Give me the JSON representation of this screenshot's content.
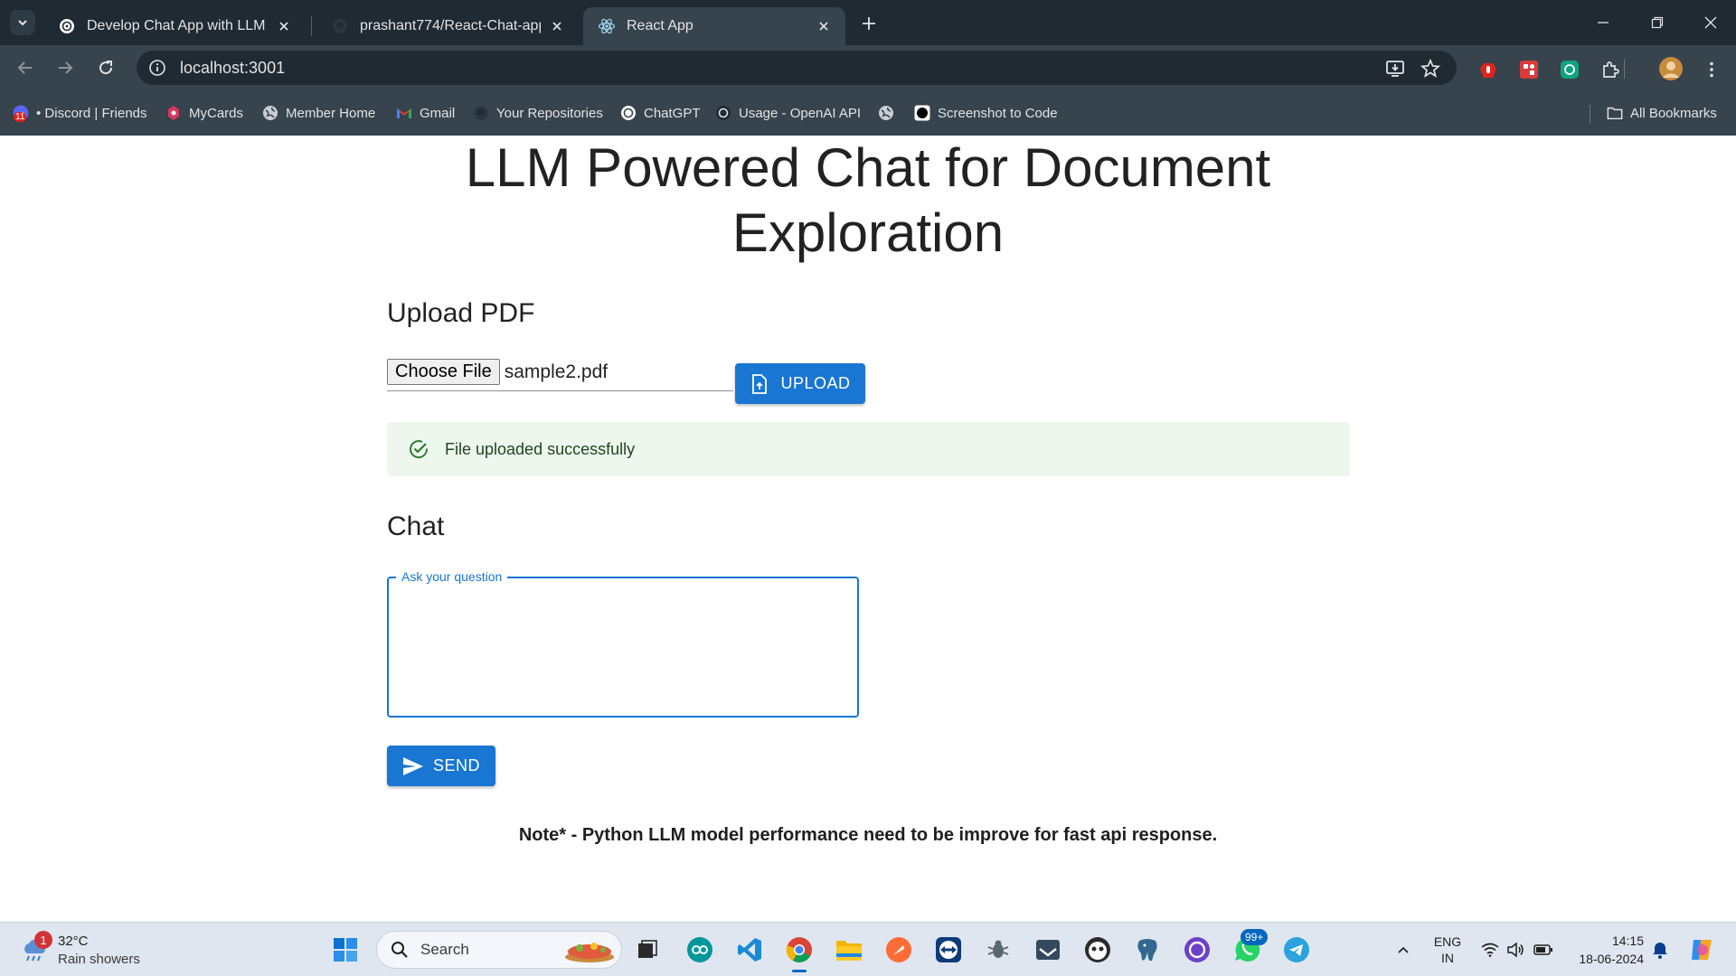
{
  "browser": {
    "tabs": [
      {
        "title": "Develop Chat App with LLM"
      },
      {
        "title": "prashant774/React-Chat-app-w"
      },
      {
        "title": "React App"
      }
    ],
    "address": "localhost:3001",
    "bookmarks": [
      {
        "label": "• Discord | Friends",
        "badge": "11"
      },
      {
        "label": "MyCards"
      },
      {
        "label": "Member Home"
      },
      {
        "label": "Gmail"
      },
      {
        "label": "Your Repositories"
      },
      {
        "label": "ChatGPT"
      },
      {
        "label": "Usage - OpenAI API"
      },
      {
        "label": "Screenshot to Code"
      }
    ],
    "all_bookmarks": "All Bookmarks"
  },
  "app": {
    "title": "LLM Powered Chat for Document Exploration",
    "upload": {
      "heading": "Upload PDF",
      "choose_label": "Choose File",
      "file_name": "sample2.pdf",
      "button": "UPLOAD"
    },
    "alert": {
      "message": "File uploaded successfully"
    },
    "chat": {
      "heading": "Chat",
      "question_label": "Ask your question",
      "question_value": "",
      "send": "SEND"
    },
    "note": "Note* - Python LLM model performance need to be improve for fast api response."
  },
  "taskbar": {
    "weather": {
      "temp": "32°C",
      "condition": "Rain showers",
      "badge": "1"
    },
    "search_placeholder": "Search",
    "whatsapp_badge": "99+",
    "lang": [
      "ENG",
      "IN"
    ],
    "time": "14:15",
    "date": "18-06-2024"
  },
  "colors": {
    "primary": "#1976d2",
    "success_bg": "#edf7ed",
    "success_icon": "#2e7d32",
    "chrome_dark": "#1f2a33",
    "chrome_toolbar": "#37434d"
  }
}
